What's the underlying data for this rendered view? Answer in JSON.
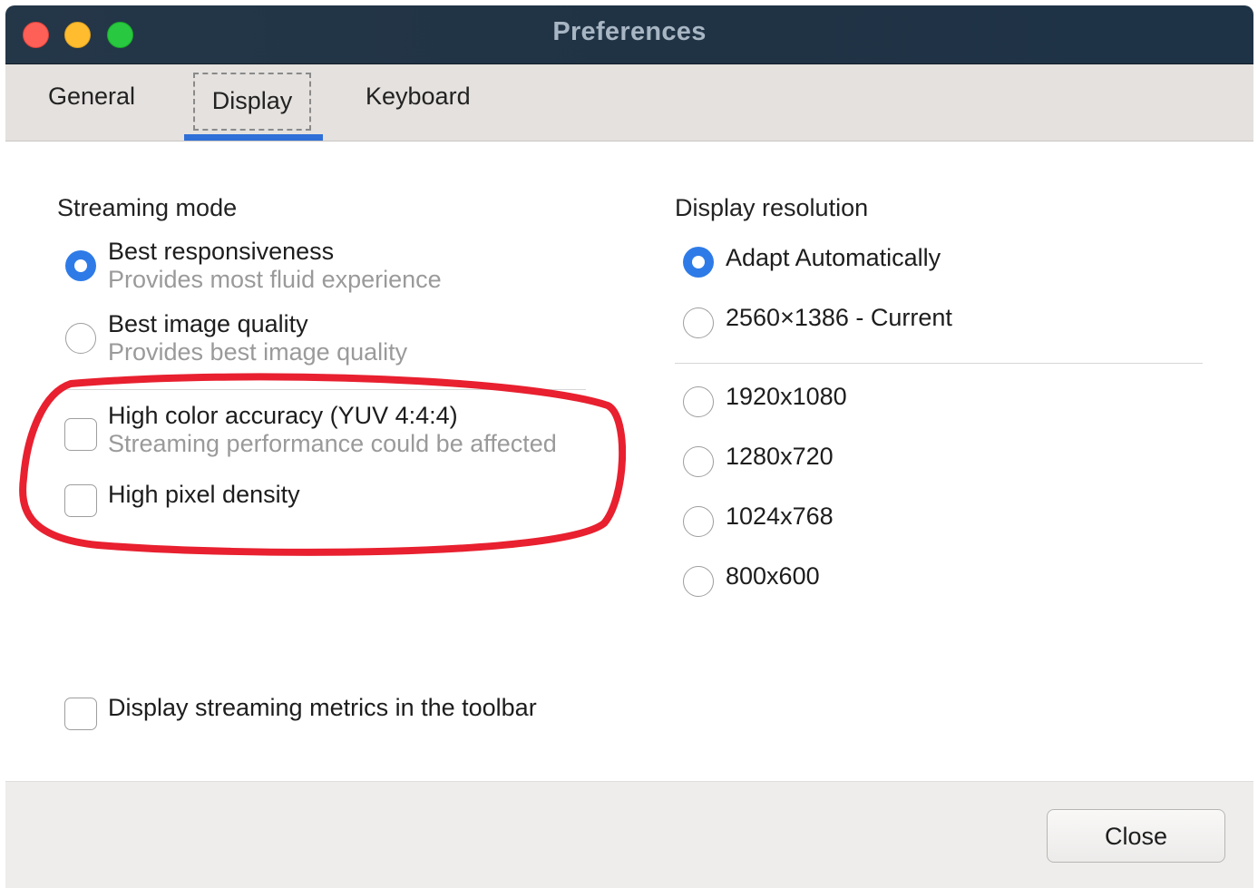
{
  "window": {
    "title": "Preferences"
  },
  "tabs": [
    {
      "label": "General",
      "selected": false
    },
    {
      "label": "Display",
      "selected": true
    },
    {
      "label": "Keyboard",
      "selected": false
    }
  ],
  "streaming": {
    "title": "Streaming mode",
    "options": [
      {
        "label": "Best responsiveness",
        "description": "Provides most fluid experience",
        "checked": true
      },
      {
        "label": "Best image quality",
        "description": "Provides best image quality",
        "checked": false
      }
    ],
    "checkboxes": [
      {
        "label": "High color accuracy (YUV 4:4:4)",
        "description": "Streaming performance could be affected",
        "checked": false
      },
      {
        "label": "High pixel density",
        "checked": false
      }
    ],
    "metrics": {
      "label": "Display streaming metrics in the toolbar",
      "checked": false
    }
  },
  "resolution": {
    "title": "Display resolution",
    "options": [
      {
        "label": "Adapt Automatically",
        "checked": true
      },
      {
        "label": "2560×1386 - Current",
        "checked": false
      },
      {
        "label": "1920x1080",
        "checked": false
      },
      {
        "label": "1280x720",
        "checked": false
      },
      {
        "label": "1024x768",
        "checked": false
      },
      {
        "label": "800x600",
        "checked": false
      }
    ]
  },
  "footer": {
    "close_label": "Close"
  },
  "colors": {
    "accent": "#2e7be8",
    "annotation": "#e8202f"
  }
}
